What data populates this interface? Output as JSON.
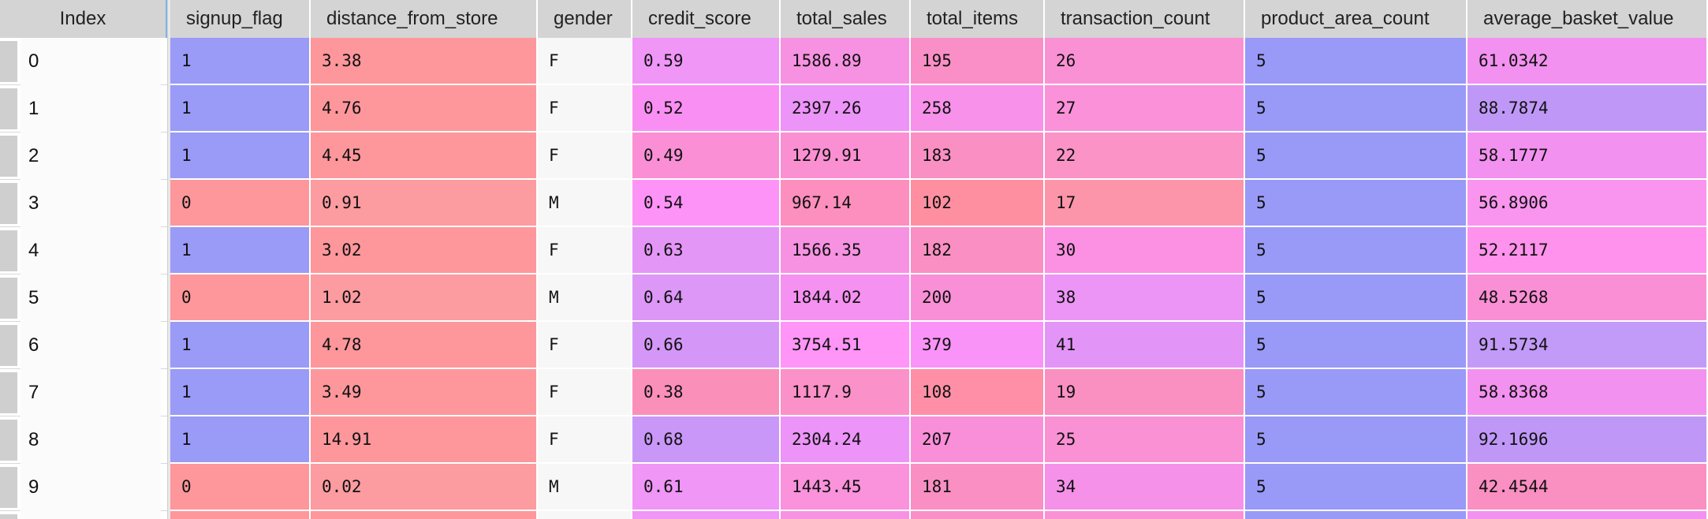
{
  "index_header": "Index",
  "columns": [
    "signup_flag",
    "distance_from_store",
    "gender",
    "credit_score",
    "total_sales",
    "total_items",
    "transaction_count",
    "product_area_count",
    "average_basket_value"
  ],
  "rows": [
    {
      "index": "0",
      "cells": [
        "1",
        "3.38",
        "F",
        "0.59",
        "1586.89",
        "195",
        "26",
        "5",
        "61.0342"
      ]
    },
    {
      "index": "1",
      "cells": [
        "1",
        "4.76",
        "F",
        "0.52",
        "2397.26",
        "258",
        "27",
        "5",
        "88.7874"
      ]
    },
    {
      "index": "2",
      "cells": [
        "1",
        "4.45",
        "F",
        "0.49",
        "1279.91",
        "183",
        "22",
        "5",
        "58.1777"
      ]
    },
    {
      "index": "3",
      "cells": [
        "0",
        "0.91",
        "M",
        "0.54",
        "967.14",
        "102",
        "17",
        "5",
        "56.8906"
      ]
    },
    {
      "index": "4",
      "cells": [
        "1",
        "3.02",
        "F",
        "0.63",
        "1566.35",
        "182",
        "30",
        "5",
        "52.2117"
      ]
    },
    {
      "index": "5",
      "cells": [
        "0",
        "1.02",
        "M",
        "0.64",
        "1844.02",
        "200",
        "38",
        "5",
        "48.5268"
      ]
    },
    {
      "index": "6",
      "cells": [
        "1",
        "4.78",
        "F",
        "0.66",
        "3754.51",
        "379",
        "41",
        "5",
        "91.5734"
      ]
    },
    {
      "index": "7",
      "cells": [
        "1",
        "3.49",
        "F",
        "0.38",
        "1117.9",
        "108",
        "19",
        "5",
        "58.8368"
      ]
    },
    {
      "index": "8",
      "cells": [
        "1",
        "14.91",
        "F",
        "0.68",
        "2304.24",
        "207",
        "25",
        "5",
        "92.1696"
      ]
    },
    {
      "index": "9",
      "cells": [
        "0",
        "0.02",
        "M",
        "0.61",
        "1443.45",
        "181",
        "34",
        "5",
        "42.4544"
      ]
    }
  ],
  "cell_colors": [
    [
      "#9a9af7",
      "#fd979b",
      "#f7f7f7",
      "#ef96f7",
      "#f792e2",
      "#f98fc6",
      "#fb91d5",
      "#9999f7",
      "#f291ef"
    ],
    [
      "#9a9af7",
      "#fd979b",
      "#f7f7f7",
      "#f98ff3",
      "#ec94f7",
      "#f891ea",
      "#fa91d9",
      "#9999f7",
      "#bf98f7"
    ],
    [
      "#9a9af7",
      "#fd979b",
      "#f7f7f7",
      "#fa8fd6",
      "#fa90d2",
      "#f98fc2",
      "#fb93c6",
      "#9999f7",
      "#f291ef"
    ],
    [
      "#fd979b",
      "#fc9ba0",
      "#f7f7f7",
      "#fe93f7",
      "#fc8fbd",
      "#fe8fa0",
      "#fd95aa",
      "#9999f7",
      "#f995ee"
    ],
    [
      "#9a9af7",
      "#fd979b",
      "#f7f7f7",
      "#e496f7",
      "#f792e2",
      "#f98fc2",
      "#fc90e2",
      "#9999f7",
      "#fe92ec"
    ],
    [
      "#fd979b",
      "#fc9ba0",
      "#f7f7f7",
      "#dc97f7",
      "#f591f0",
      "#f98fd6",
      "#ec95f7",
      "#9999f7",
      "#fa8fd6"
    ],
    [
      "#9a9af7",
      "#fd979b",
      "#f7f7f7",
      "#d497f7",
      "#fe95f7",
      "#f993f7",
      "#e295f7",
      "#9999f7",
      "#c29af7"
    ],
    [
      "#9a9af7",
      "#fd979b",
      "#f7f7f7",
      "#fa8fba",
      "#fb91c9",
      "#fe8fa6",
      "#fa90c1",
      "#9999f7",
      "#f291ef"
    ],
    [
      "#9a9af7",
      "#fd979b",
      "#f7f7f7",
      "#c997f7",
      "#ec94f7",
      "#f98fd8",
      "#fa91d5",
      "#9999f7",
      "#bf98f7"
    ],
    [
      "#fd979b",
      "#fc9ba0",
      "#f7f7f7",
      "#ef96f7",
      "#fa92dc",
      "#f98fc2",
      "#f691ea",
      "#9999f7",
      "#fa8fc2"
    ]
  ],
  "partial_row_colors": [
    "#fd979b",
    "#fd979b",
    "#f7f7f7",
    "#ef96f7",
    "#f792e2",
    "#f98fc6",
    "#fb91d5",
    "#9999f7",
    "#f291ef"
  ]
}
